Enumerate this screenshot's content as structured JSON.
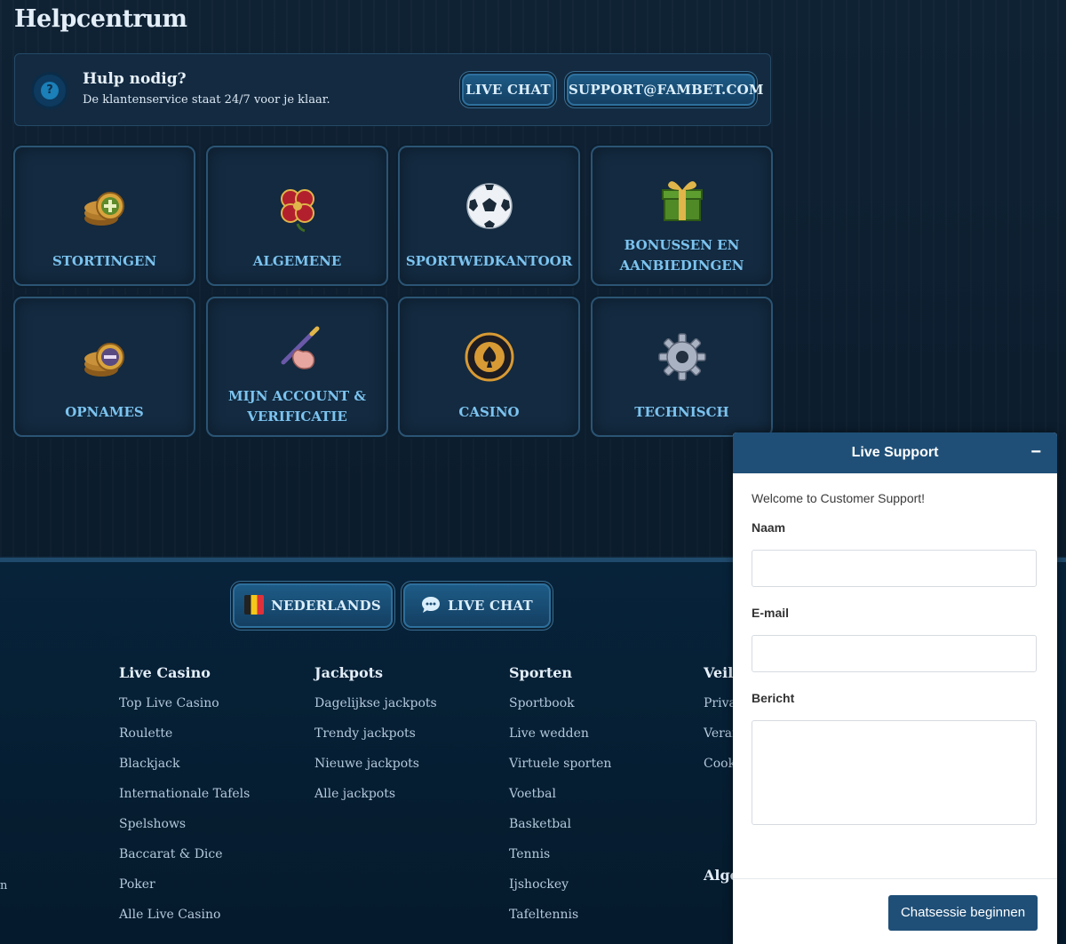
{
  "page": {
    "title": "Helpcentrum"
  },
  "help": {
    "heading": "Hulp nodig?",
    "subtitle": "De klantenservice staat 24/7 voor je klaar.",
    "icon": "question-icon",
    "live_chat_label": "LIVE CHAT",
    "email_label": "SUPPORT@FAMBET.COM"
  },
  "categories": [
    {
      "label": "STORTINGEN",
      "icon": "coins-plus-icon"
    },
    {
      "label": "ALGEMENE",
      "icon": "clover-icon"
    },
    {
      "label": "SPORTWEDKANTOOR",
      "icon": "soccer-ball-icon"
    },
    {
      "label_line1": "BONUSSEN EN",
      "label_line2": "AANBIEDINGEN",
      "icon": "gift-icon"
    },
    {
      "label": "OPNAMES",
      "icon": "coins-minus-icon"
    },
    {
      "label_line1": "MIJN ACCOUNT &",
      "label_line2": "VERIFICATIE",
      "icon": "hand-pen-icon"
    },
    {
      "label": "CASINO",
      "icon": "casino-chip-icon"
    },
    {
      "label": "TECHNISCH",
      "icon": "gear-icon"
    }
  ],
  "footer": {
    "language_label": "NEDERLANDS",
    "live_chat_label": "LIVE CHAT",
    "columns": [
      {
        "heading": "Live Casino",
        "links": [
          "Top Live Casino",
          "Roulette",
          "Blackjack",
          "Internationale Tafels",
          "Spelshows",
          "Baccarat & Dice",
          "Poker",
          "Alle Live Casino"
        ]
      },
      {
        "heading": "Jackpots",
        "links": [
          "Dagelijkse jackpots",
          "Trendy jackpots",
          "Nieuwe jackpots",
          "Alle jackpots"
        ]
      },
      {
        "heading": "Sporten",
        "links": [
          "Sportbook",
          "Live wedden",
          "Virtuele sporten",
          "Voetbal",
          "Basketbal",
          "Tennis",
          "Ijshockey",
          "Tafeltennis"
        ]
      },
      {
        "heading": "Veili",
        "links": [
          "Priva",
          "Veran",
          "Cooki"
        ]
      }
    ],
    "partial_heading": "Alge",
    "edge_text": "n"
  },
  "chat": {
    "title": "Live Support",
    "minimize": "−",
    "welcome": "Welcome to Customer Support!",
    "name_label": "Naam",
    "email_label": "E-mail",
    "message_label": "Bericht",
    "submit_label": "Chatsessie beginnen"
  },
  "colors": {
    "accent": "#7cc3ef",
    "chat_header": "#1f4f77",
    "background": "#0f2234"
  }
}
